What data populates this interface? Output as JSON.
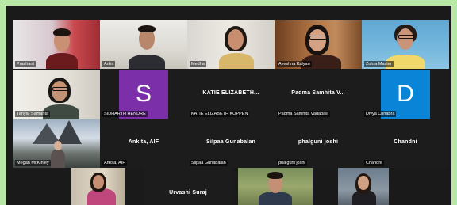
{
  "participants": [
    {
      "name": "Prashant",
      "avatar_letter": "",
      "avatar_color": ""
    },
    {
      "name": "Ankit",
      "avatar_letter": "",
      "avatar_color": ""
    },
    {
      "name": "Medha",
      "avatar_letter": "",
      "avatar_color": ""
    },
    {
      "name": "Ayeshna Kalyan",
      "avatar_letter": "",
      "avatar_color": ""
    },
    {
      "name": "Zohra Master",
      "avatar_letter": "",
      "avatar_color": ""
    },
    {
      "name": "Tanya- Samanta",
      "avatar_letter": "",
      "avatar_color": ""
    },
    {
      "name": "SIDHARTH HENDRE",
      "avatar_letter": "S",
      "avatar_color": "#7b2fa8"
    },
    {
      "name": "KATIE ELIZABETH KOPPEN",
      "display_name": "KATIE  ELIZABETH...",
      "avatar_letter": "",
      "avatar_color": ""
    },
    {
      "name": "Padma Samhita Vadapalli",
      "display_name": "Padma Samhita V...",
      "avatar_letter": "",
      "avatar_color": ""
    },
    {
      "name": "Divya Chhabra",
      "avatar_letter": "D",
      "avatar_color": "#0a84d6"
    },
    {
      "name": "Megan McKinley",
      "avatar_letter": "",
      "avatar_color": ""
    },
    {
      "name": "Ankita, AIF",
      "display_name": "Ankita, AIF",
      "avatar_letter": "",
      "avatar_color": ""
    },
    {
      "name": "Silpaa Gunabalan",
      "display_name": "Silpaa Gunabalan",
      "avatar_letter": "",
      "avatar_color": ""
    },
    {
      "name": "phalguni joshi",
      "display_name": "phalguni joshi",
      "avatar_letter": "",
      "avatar_color": ""
    },
    {
      "name": "Chandni",
      "display_name": "Chandni",
      "avatar_letter": "",
      "avatar_color": ""
    },
    {
      "name": "",
      "avatar_letter": "",
      "avatar_color": ""
    },
    {
      "name": "Urvashi Suraj",
      "display_name": "Urvashi Suraj",
      "avatar_letter": "",
      "avatar_color": ""
    },
    {
      "name": "",
      "avatar_letter": "",
      "avatar_color": ""
    },
    {
      "name": "",
      "avatar_letter": "",
      "avatar_color": ""
    }
  ]
}
